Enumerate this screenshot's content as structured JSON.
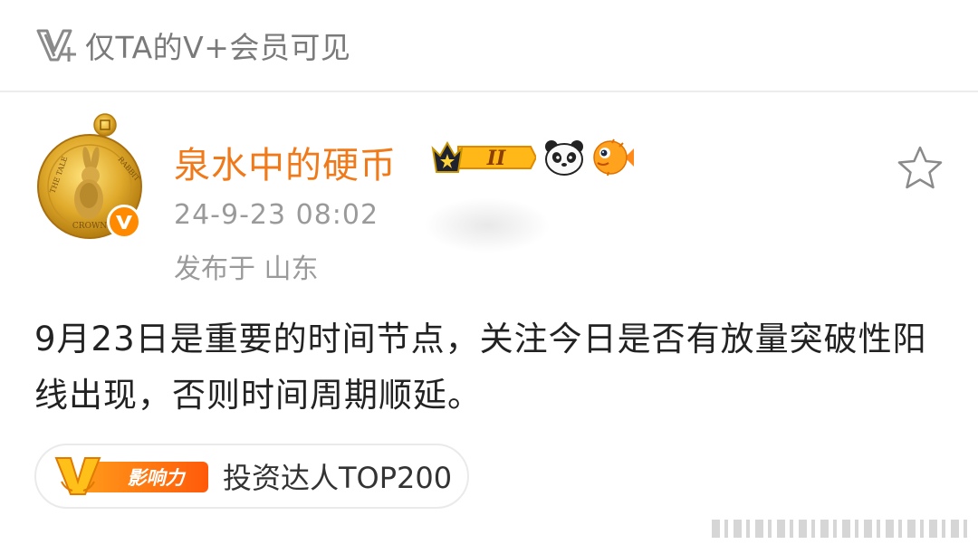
{
  "visibility_banner": {
    "icon": "v-plus-icon",
    "text": "仅TA的V+会员可见"
  },
  "author": {
    "name": "泉水中的硬币",
    "avatar": "peter-rabbit-coin-avatar",
    "verified_color": "#ff8a00",
    "badges": [
      "crown-level-2-badge",
      "panda-icon",
      "pufferfish-icon"
    ],
    "level_badge_text": "II"
  },
  "post": {
    "time": "24-9-23 08:02",
    "location": "发布于 山东",
    "text": "9月23日是重要的时间节点，关注今日是否有放量突破性阳线出现，否则时间周期顺延。"
  },
  "influence": {
    "badge_label": "影响力",
    "text": "投资达人TOP200"
  },
  "colors": {
    "accent": "#f07a1a",
    "muted": "#9a9a9a",
    "body": "#222222"
  }
}
